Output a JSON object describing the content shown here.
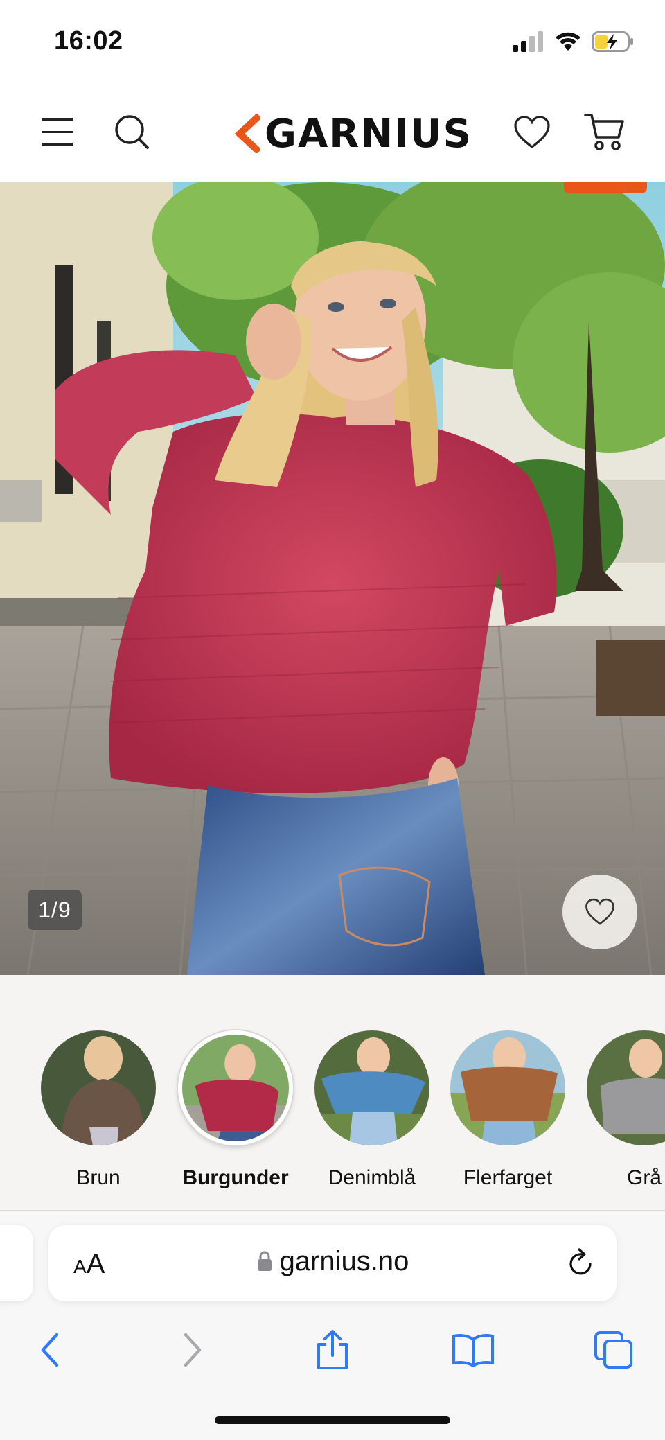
{
  "status_bar": {
    "time": "16:02"
  },
  "header": {
    "brand": "GARNIUS",
    "colors": {
      "accent": "#e8561a",
      "text": "#111111"
    }
  },
  "gallery": {
    "counter": "1/9"
  },
  "variants": [
    {
      "label": "Brun",
      "selected": false,
      "color": "#6b5546"
    },
    {
      "label": "Burgunder",
      "selected": true,
      "color": "#b32a48"
    },
    {
      "label": "Denimblå",
      "selected": false,
      "color": "#4e8bc0"
    },
    {
      "label": "Flerfarget",
      "selected": false,
      "color": "#a5643a"
    },
    {
      "label": "Grå",
      "selected": false,
      "color": "#9a9a9c"
    }
  ],
  "browser": {
    "aa_label_small": "A",
    "aa_label_large": "A",
    "url": "garnius.no"
  }
}
